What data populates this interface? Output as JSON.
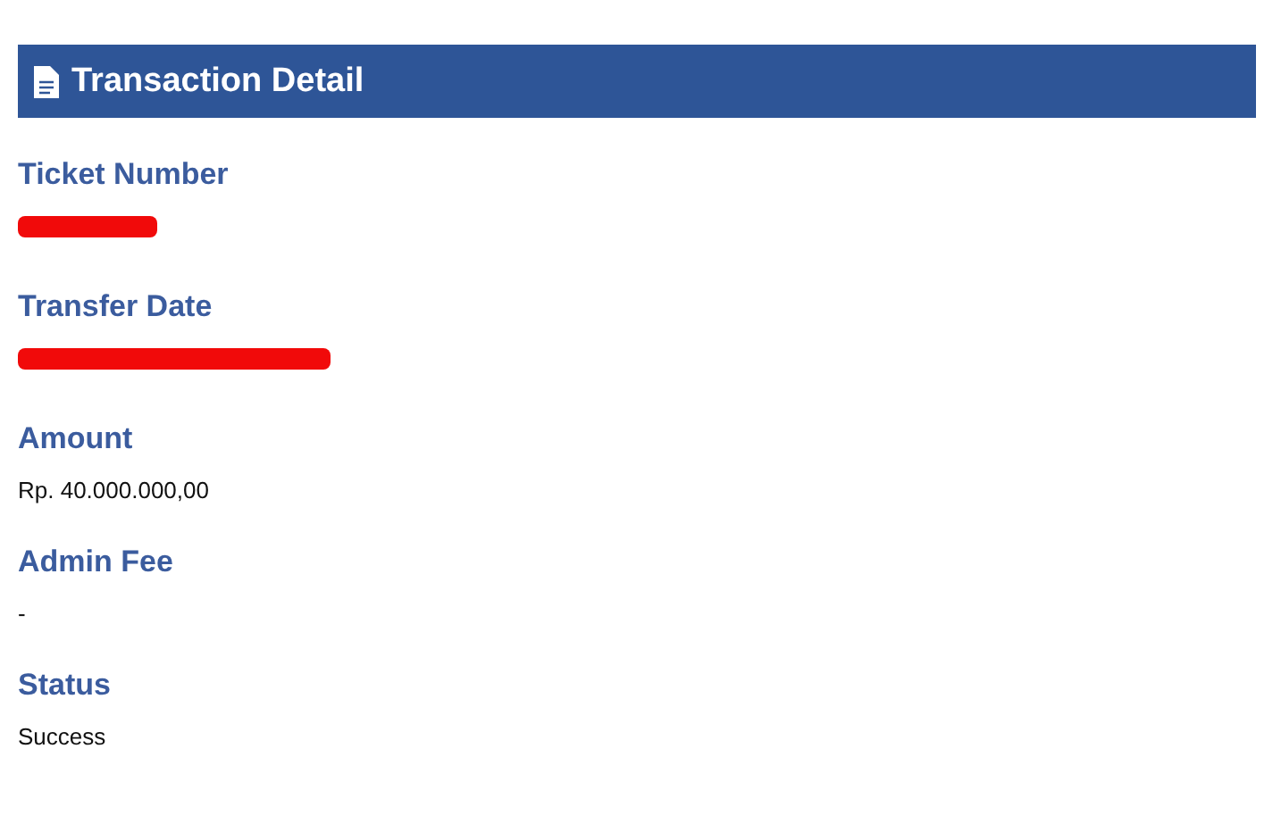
{
  "header": {
    "title": "Transaction Detail"
  },
  "fields": [
    {
      "label": "Ticket Number",
      "kind": "redacted"
    },
    {
      "label": "Transfer Date",
      "kind": "redacted"
    },
    {
      "label": "Amount",
      "kind": "text",
      "value": "Rp. 40.000.000,00"
    },
    {
      "label": "Admin Fee",
      "kind": "text",
      "value": "-"
    },
    {
      "label": "Status",
      "kind": "text",
      "value": "Success"
    }
  ]
}
